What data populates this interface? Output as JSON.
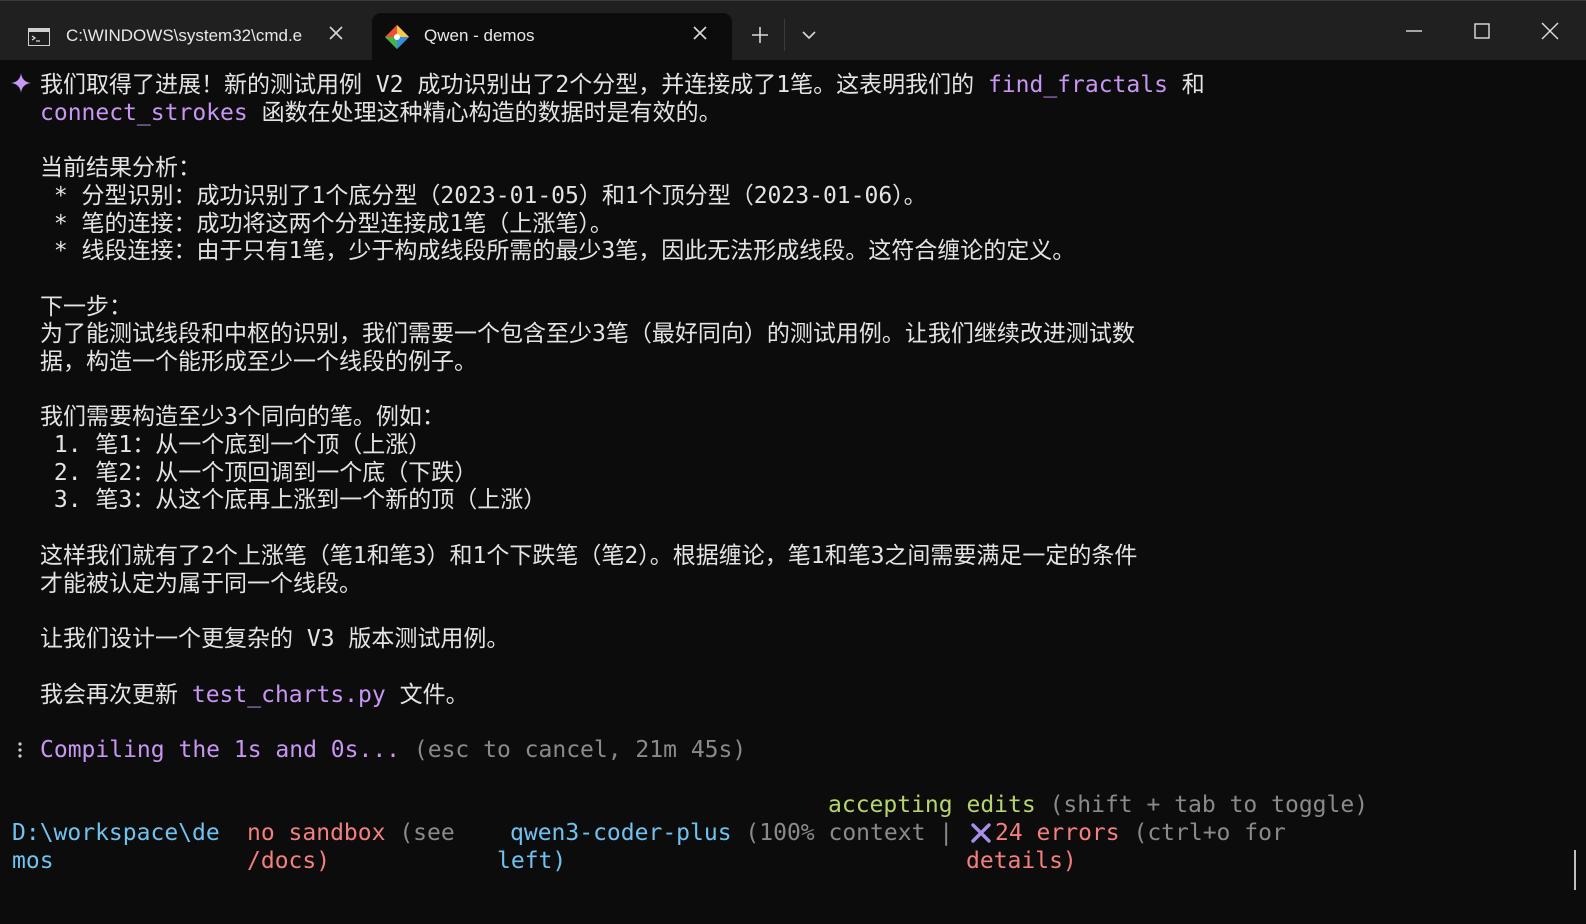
{
  "tabs": [
    {
      "label": "C:\\WINDOWS\\system32\\cmd.e",
      "icon": "cmd-icon"
    },
    {
      "label": "Qwen - demos",
      "icon": "git-icon"
    }
  ],
  "message": {
    "l1a": "我们取得了进展！新的测试用例 V2 成功识别出了2个分型，并连接成了1笔。这表明我们的 ",
    "l1b": "find_fractals",
    "l1c": " 和",
    "l2a": "connect_strokes",
    "l2b": " 函数在处理这种精心构造的数据时是有效的。",
    "analysis_title": "当前结果分析：",
    "analysis_1": " * 分型识别：成功识别了1个底分型（2023-01-05）和1个顶分型（2023-01-06）。",
    "analysis_2": " * 笔的连接：成功将这两个分型连接成1笔（上涨笔）。",
    "analysis_3": " * 线段连接：由于只有1笔，少于构成线段所需的最少3笔，因此无法形成线段。这符合缠论的定义。",
    "next_title": "下一步：",
    "next_1": "为了能测试线段和中枢的识别，我们需要一个包含至少3笔（最好同向）的测试用例。让我们继续改进测试数",
    "next_2": "据，构造一个能形成至少一个线段的例子。",
    "need_title": "我们需要构造至少3个同向的笔。例如：",
    "need_1": " 1. 笔1：从一个底到一个顶（上涨）",
    "need_2": " 2. 笔2：从一个顶回调到一个底（下跌）",
    "need_3": " 3. 笔3：从这个底再上涨到一个新的顶（上涨）",
    "result_1": "这样我们就有了2个上涨笔（笔1和笔3）和1个下跌笔（笔2）。根据缠论，笔1和笔3之间需要满足一定的条件",
    "result_2": "才能被认定为属于同一个线段。",
    "design": "让我们设计一个更复杂的 V3 版本测试用例。",
    "update_a": "我会再次更新 ",
    "update_b": "test_charts.py",
    "update_c": " 文件。"
  },
  "progress": {
    "text": "Compiling the 1s and 0s...",
    "hint": " (esc to cancel, 21m 45s)"
  },
  "statusbar": {
    "mode_a": "accepting edits",
    "mode_b": " (shift + tab to toggle)",
    "cwd_1": "D:\\workspace\\de",
    "cwd_2": "mos",
    "sandbox_1a": "no sandbox",
    "sandbox_1b": " (see",
    "sandbox_2": "/docs)",
    "model_1a": "qwen3-coder-plus",
    "model_1b": " (100% context |",
    "model_2": "left)",
    "errors_1a": "24 errors",
    "errors_1b": " (ctrl+o for",
    "errors_2": "details)"
  }
}
